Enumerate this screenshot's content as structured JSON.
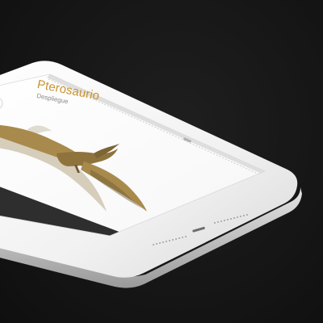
{
  "app": {
    "title": "Pterosaurio",
    "subtitle": "Despliegue"
  },
  "colors": {
    "background": "#161616",
    "device_frame": "#f2f2f2",
    "screen_bg": "#ffffff",
    "title_accent": "#c9922e",
    "creature_body": "#a88a4c",
    "creature_shadow": "#6f5a33",
    "panel_dark": "#2e2e2e"
  },
  "icons": [
    "pterosaur-illustration",
    "home-button",
    "speaker-grille",
    "lightning-port"
  ]
}
